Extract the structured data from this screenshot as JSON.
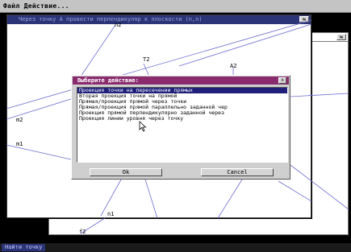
{
  "menubar": {
    "label": "Файл Действие..."
  },
  "main_window": {
    "title": "Через точку А провести перпендикуляр к плоскости (n,n)",
    "close_glyph": "⇆"
  },
  "back_window": {
    "close_glyph": "⇆"
  },
  "drawing_labels": {
    "n2": "n2",
    "t2": "T2",
    "a2": "A2",
    "m2": "m2",
    "m1": "m1",
    "n1": "n1",
    "f2": "f2"
  },
  "dialog": {
    "title": "Выберите действие:",
    "close_glyph": "x",
    "items": [
      "Проекция точки на пересечении прямых",
      "Вторая проекция точки на прямой",
      "Прямая/проекция прямой через точки",
      "Прямая/проекция прямой параллельно заданной чер",
      "Проекция прямой перпендикулярно заданной через",
      "Проекция линии уровня через точку"
    ],
    "selected_index": 0,
    "ok_label": "Ok",
    "cancel_label": "Cancel"
  },
  "statusbar": {
    "button_label": "Найти точку"
  },
  "colors": {
    "main_title_bg": "#2c3478",
    "dialog_title_bg": "#8a2b6e",
    "line_color": "#6b6bd0",
    "selection_bg": "#20207a"
  }
}
